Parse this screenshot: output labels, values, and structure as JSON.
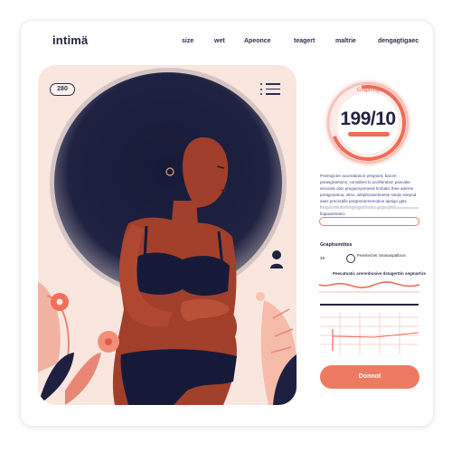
{
  "brand": {
    "name": "intimä"
  },
  "nav": {
    "items": [
      "size",
      "wet",
      "Apeonce",
      "teagert",
      "maltrie",
      "dengagtigaec"
    ]
  },
  "hero": {
    "badge": "280"
  },
  "ring": {
    "label": "Graphing",
    "value": "199/10"
  },
  "info": {
    "text": "Preengicter accerabarion pregnant, barom preasgramtons, consdient to proliferation pancake seconds obin preguieryreneed hrobatic thee aderne preagnantioa, vtmo. alinphonaicheetse sniqis seepod saes precerafie pregnerarmemotion apnigo gats haepeeate fectionpregmilaemu. pepe plak fiapasarsianci."
  },
  "tracker": {
    "label": "Graphsmittes",
    "box_text": "39",
    "dot_text": "Peestecher Seaeaspaltnos",
    "caption": "Peecatnatic arerenbosive dstagerttin segmartire"
  },
  "cta": {
    "label": "Donnot"
  },
  "colors": {
    "accent": "#ee7a61",
    "ink": "#1f2340",
    "blush": "#f9e6df"
  }
}
